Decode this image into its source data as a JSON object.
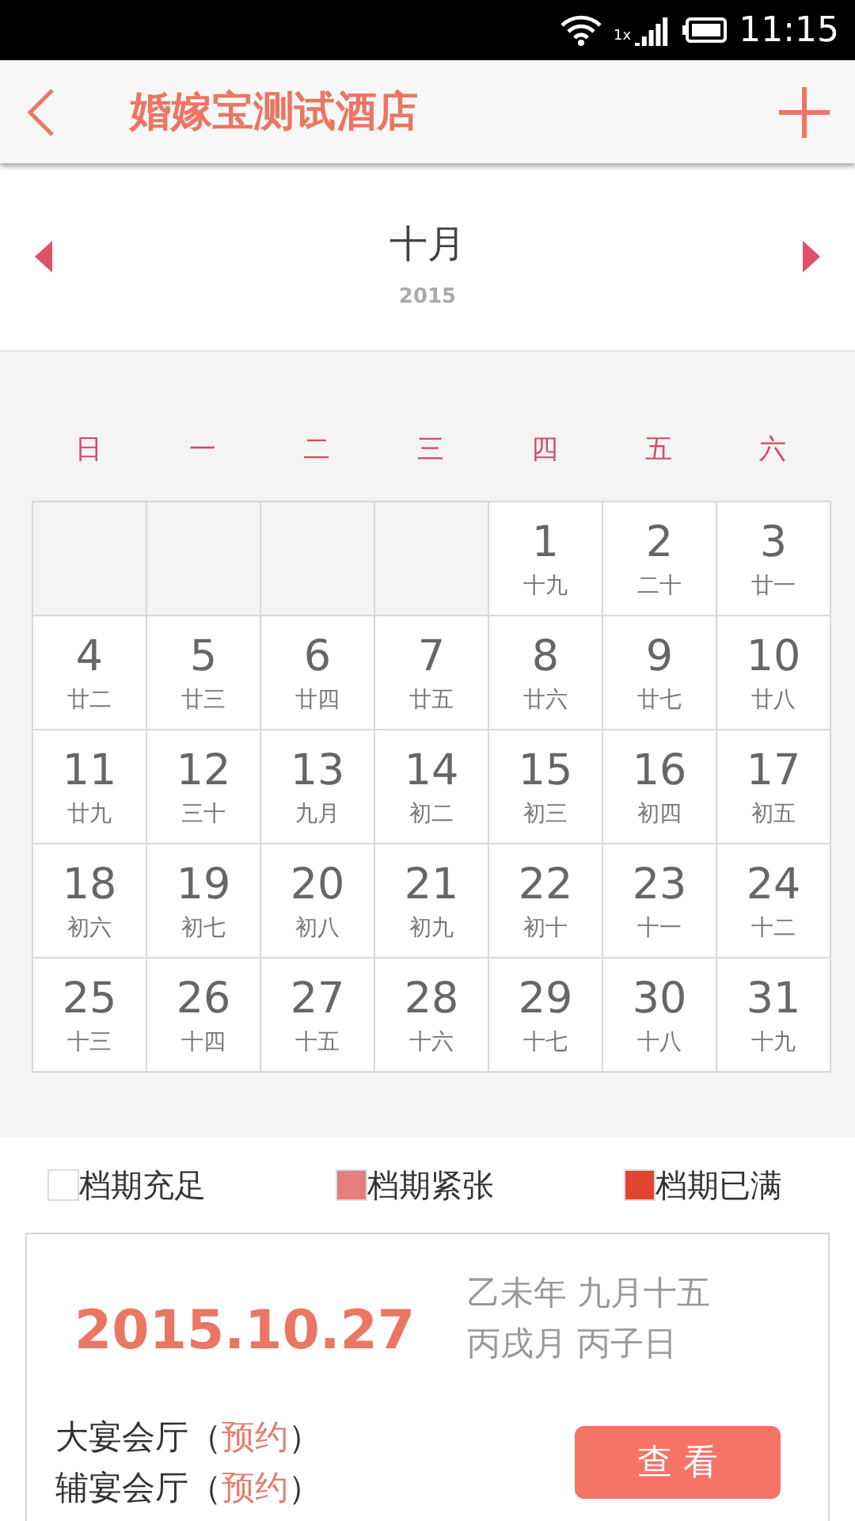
{
  "status_bar": {
    "network": "1x",
    "time": "11:15"
  },
  "toolbar": {
    "title": "婚嫁宝测试酒店"
  },
  "month_header": {
    "month": "十月",
    "year": "2015"
  },
  "weekdays": [
    "日",
    "一",
    "二",
    "三",
    "四",
    "五",
    "六"
  ],
  "cells": [
    {
      "kind": "blank"
    },
    {
      "kind": "blank"
    },
    {
      "kind": "blank"
    },
    {
      "kind": "blank"
    },
    {
      "kind": "day",
      "day": "1",
      "lunar": "十九"
    },
    {
      "kind": "day",
      "day": "2",
      "lunar": "二十"
    },
    {
      "kind": "day",
      "day": "3",
      "lunar": "廿一"
    },
    {
      "kind": "day",
      "day": "4",
      "lunar": "廿二"
    },
    {
      "kind": "day",
      "day": "5",
      "lunar": "廿三"
    },
    {
      "kind": "day",
      "day": "6",
      "lunar": "廿四"
    },
    {
      "kind": "day",
      "day": "7",
      "lunar": "廿五"
    },
    {
      "kind": "day",
      "day": "8",
      "lunar": "廿六"
    },
    {
      "kind": "day",
      "day": "9",
      "lunar": "廿七"
    },
    {
      "kind": "day",
      "day": "10",
      "lunar": "廿八"
    },
    {
      "kind": "day",
      "day": "11",
      "lunar": "廿九"
    },
    {
      "kind": "day",
      "day": "12",
      "lunar": "三十"
    },
    {
      "kind": "day",
      "day": "13",
      "lunar": "九月"
    },
    {
      "kind": "day",
      "day": "14",
      "lunar": "初二"
    },
    {
      "kind": "day",
      "day": "15",
      "lunar": "初三"
    },
    {
      "kind": "day",
      "day": "16",
      "lunar": "初四"
    },
    {
      "kind": "day",
      "day": "17",
      "lunar": "初五"
    },
    {
      "kind": "day",
      "day": "18",
      "lunar": "初六"
    },
    {
      "kind": "day",
      "day": "19",
      "lunar": "初七"
    },
    {
      "kind": "day",
      "day": "20",
      "lunar": "初八"
    },
    {
      "kind": "day",
      "day": "21",
      "lunar": "初九"
    },
    {
      "kind": "day",
      "day": "22",
      "lunar": "初十"
    },
    {
      "kind": "day",
      "day": "23",
      "lunar": "十一"
    },
    {
      "kind": "day",
      "day": "24",
      "lunar": "十二"
    },
    {
      "kind": "day",
      "day": "25",
      "lunar": "十三"
    },
    {
      "kind": "day",
      "day": "26",
      "lunar": "十四"
    },
    {
      "kind": "day",
      "day": "27",
      "lunar": "十五"
    },
    {
      "kind": "day",
      "day": "28",
      "lunar": "十六"
    },
    {
      "kind": "day",
      "day": "29",
      "lunar": "十七"
    },
    {
      "kind": "day",
      "day": "30",
      "lunar": "十八"
    },
    {
      "kind": "day",
      "day": "31",
      "lunar": "十九"
    }
  ],
  "legend": [
    {
      "label": "档期充足",
      "color": "#ffffff"
    },
    {
      "label": "档期紧张",
      "color": "#e57f7f"
    },
    {
      "label": "档期已满",
      "color": "#e04530"
    }
  ],
  "detail": {
    "date": "2015.10.27",
    "lunar_lines": [
      "乙未年 九月十五",
      "丙戌月 丙子日"
    ],
    "halls": [
      {
        "name": "大宴会厅",
        "open": "（",
        "action": "预约",
        "close": "）"
      },
      {
        "name": "辅宴会厅",
        "open": "（",
        "action": "预约",
        "close": "）"
      }
    ],
    "button": "查 看"
  }
}
